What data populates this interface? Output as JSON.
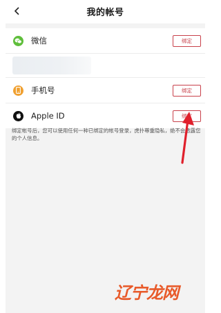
{
  "nav": {
    "title": "我的帐号",
    "back_icon": "chevron-left-icon"
  },
  "accounts": [
    {
      "label": "微信",
      "icon": "wechat-icon",
      "icon_color": "#5fbe3b",
      "button": "绑定"
    },
    {
      "label": "手机号",
      "icon": "phone-icon",
      "icon_color": "#f0a030",
      "button": "绑定"
    },
    {
      "label": "Apple ID",
      "icon": "apple-icon",
      "icon_color": "#111111",
      "button": "绑定"
    }
  ],
  "notice": "绑定帐号后，您可以使用任何一种已绑定的帐号登录，虎扑尊重隐私，绝不会透露您的个人信息。",
  "watermark": "辽宁龙网",
  "colors": {
    "accent": "#c8404a",
    "arrow": "#e0202c"
  }
}
